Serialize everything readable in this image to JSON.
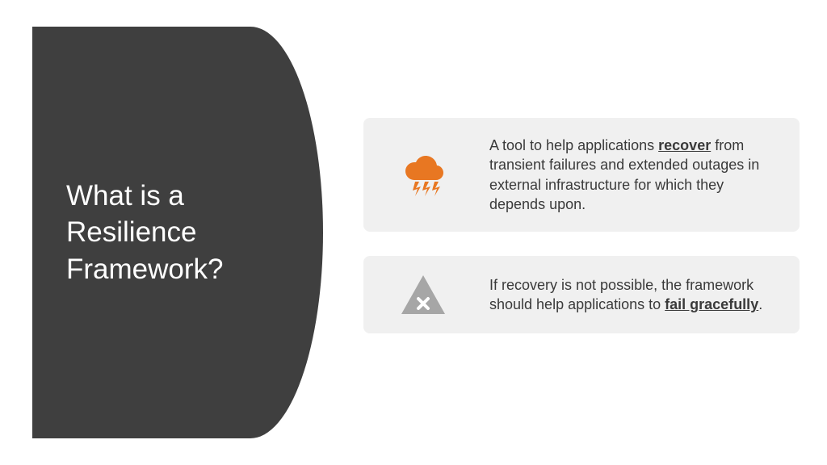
{
  "title": "What is a Resilience Framework?",
  "cards": [
    {
      "icon": "storm-cloud",
      "icon_color": "#E87722",
      "html": "A tool to help applications <b>recover</b> from transient failures and extended outages in external infrastructure for which they depends upon."
    },
    {
      "icon": "warning-x",
      "icon_color": "#A6A6A6",
      "html": "If recovery is not possible, the framework should help applications to <b>fail gracefully</b>."
    }
  ]
}
